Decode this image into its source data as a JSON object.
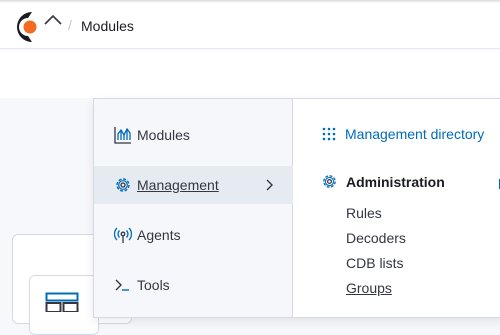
{
  "header": {
    "breadcrumb": "Modules"
  },
  "menu": {
    "left_items": [
      {
        "label": "Modules",
        "icon": "chart-icon"
      },
      {
        "label": "Management",
        "icon": "gear-icon",
        "active": true
      },
      {
        "label": "Agents",
        "icon": "broadcast-icon"
      },
      {
        "label": "Tools",
        "icon": "console-icon"
      }
    ],
    "management_directory": "Management directory",
    "administration": {
      "title": "Administration",
      "links": [
        "Rules",
        "Decoders",
        "CDB lists",
        "Groups"
      ]
    }
  },
  "colors": {
    "accent": "#006bb8",
    "logo_orange": "#f26b21"
  }
}
